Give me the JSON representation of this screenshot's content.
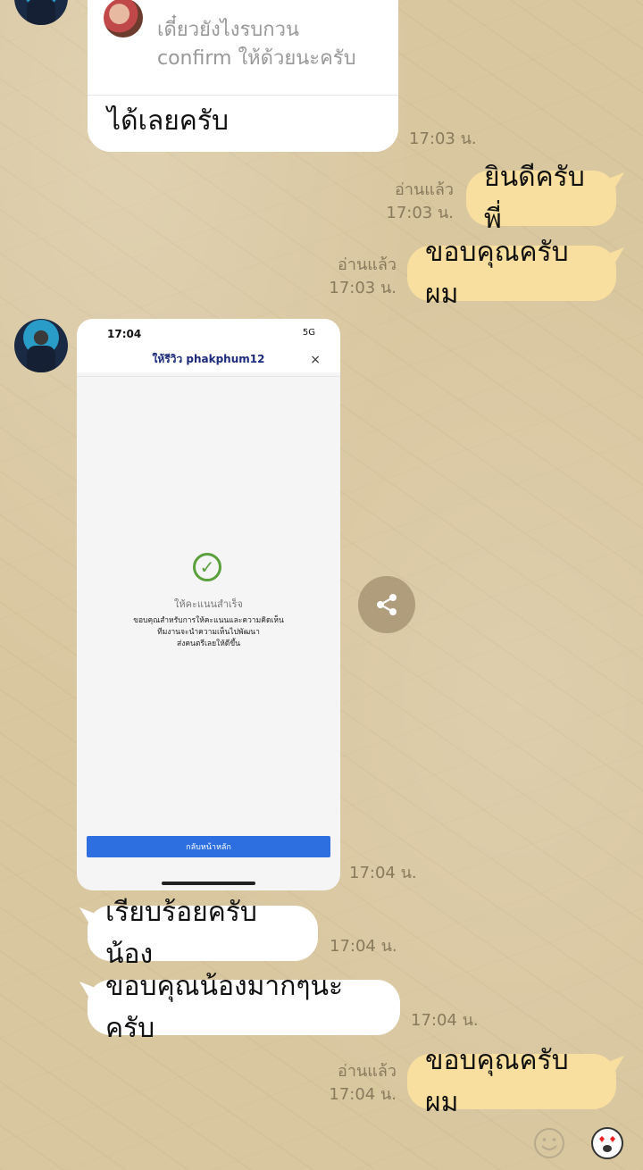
{
  "messages": {
    "m1": {
      "quote_line1": "เดี๋ยวยังไงรบกวน",
      "quote_line2": "confirm ให้ด้วยนะครับ",
      "text": "ได้เลยครับ",
      "time": "17:03 น."
    },
    "m2": {
      "read": "อ่านแล้ว",
      "time": "17:03 น.",
      "text": "ยินดีครับพี่"
    },
    "m3": {
      "read": "อ่านแล้ว",
      "time": "17:03 น.",
      "text": "ขอบคุณครับผม"
    },
    "m4": {
      "time": "17:04 น."
    },
    "m5": {
      "text": "เรียบร้อยครับน้อง",
      "time": "17:04 น."
    },
    "m6": {
      "text": "ขอบคุณน้องมากๆนะครับ",
      "time": "17:04 น."
    },
    "m7": {
      "read": "อ่านแล้ว",
      "time": "17:04 น.",
      "text": "ขอบคุณครับผม"
    }
  },
  "screenshot": {
    "status_time": "17:04",
    "signal": "5G",
    "title": "ให้รีวิว phakphum12",
    "close": "×",
    "check": "✓",
    "success": "ให้คะแนนสำเร็จ",
    "thanks_line1": "ขอบคุณสำหรับการให้คะแนนและความคิดเห็น",
    "thanks_line2": "ทีมงานจะนำความเห็นไปพัฒนา",
    "thanks_line3": "ส่งคนตรีเลยให้ดีขึ้น",
    "button": "กลับหน้าหลัก"
  },
  "icons": {
    "share": "share-icon",
    "emoji": "emoji-icon",
    "sticker": "sticker-icon"
  },
  "colors": {
    "incoming_bubble": "#ffffff",
    "outgoing_bubble": "#f8df9f",
    "accent_blue": "#2d6fe0"
  }
}
